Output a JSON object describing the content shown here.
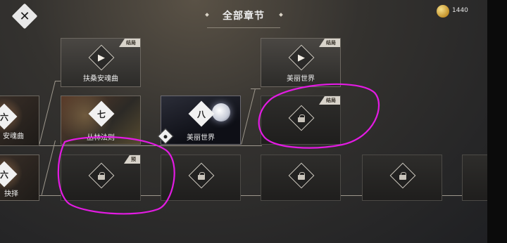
{
  "header": {
    "title": "全部章节",
    "coin_count": "1440"
  },
  "badges": {
    "finale": "结局",
    "preview": "预"
  },
  "chapters": {
    "ch6_top_label": "安魂曲",
    "ch6_top_numeral": "六",
    "ch6_bottom_label": "抉择",
    "ch6_bottom_numeral": "六",
    "ch7_label": "丛林法则",
    "ch7_numeral": "七",
    "ch8_label": "美丽世界",
    "ch8_numeral": "八",
    "ending1_label": "扶桑安魂曲",
    "ending2_label": "美丽世界"
  },
  "colors": {
    "annotation": "#e31be3",
    "badge": "#d9d4cb"
  }
}
